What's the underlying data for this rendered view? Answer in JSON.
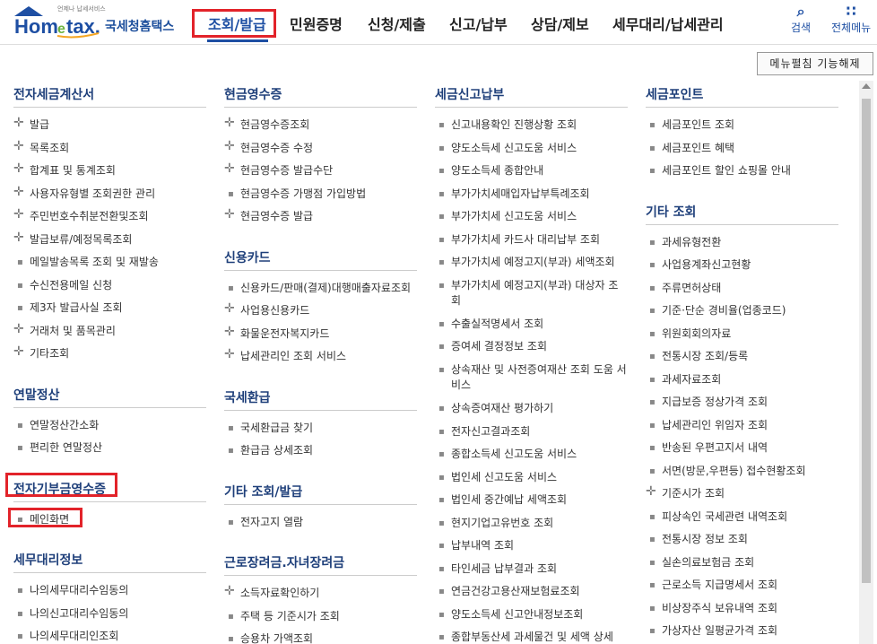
{
  "logo": {
    "small_text": "언제나 납세서비스",
    "name_ko": "국세청홈택스"
  },
  "gnb": [
    {
      "label": "조회/발급"
    },
    {
      "label": "민원증명"
    },
    {
      "label": "신청/제출"
    },
    {
      "label": "신고/납부"
    },
    {
      "label": "상담/제보"
    },
    {
      "label": "세무대리/납세관리"
    }
  ],
  "util": {
    "search": "검색",
    "all_menu": "전체메뉴"
  },
  "menu_toggle_button": "메뉴펼침 기능해제",
  "columns": [
    {
      "sections": [
        {
          "title": "전자세금계산서",
          "items": [
            {
              "t": "발급",
              "p": true
            },
            {
              "t": "목록조회",
              "p": true
            },
            {
              "t": "합계표 및 통계조회",
              "p": true
            },
            {
              "t": "사용자유형별 조회권한 관리",
              "p": true
            },
            {
              "t": "주민번호수취분전환및조회",
              "p": true
            },
            {
              "t": "발급보류/예정목록조회",
              "p": true
            },
            {
              "t": "메일발송목록 조회 및 재발송",
              "p": false
            },
            {
              "t": "수신전용메일 신청",
              "p": false
            },
            {
              "t": "제3자 발급사실 조회",
              "p": false
            },
            {
              "t": "거래처 및 품목관리",
              "p": true
            },
            {
              "t": "기타조회",
              "p": true
            }
          ]
        },
        {
          "title": "연말정산",
          "items": [
            {
              "t": "연말정산간소화",
              "p": false
            },
            {
              "t": "편리한 연말정산",
              "p": false
            }
          ]
        },
        {
          "title": "전자기부금영수증",
          "items": [
            {
              "t": "메인화면",
              "p": false
            }
          ]
        },
        {
          "title": "세무대리정보",
          "items": [
            {
              "t": "나의세무대리수임동의",
              "p": false
            },
            {
              "t": "나의신고대리수임동의",
              "p": false
            },
            {
              "t": "나의세무대리인조회",
              "p": false
            }
          ]
        }
      ]
    },
    {
      "sections": [
        {
          "title": "현금영수증",
          "items": [
            {
              "t": "현금영수증조회",
              "p": true
            },
            {
              "t": "현금영수증 수정",
              "p": true
            },
            {
              "t": "현금영수증 발급수단",
              "p": true
            },
            {
              "t": "현금영수증 가맹점 가입방법",
              "p": false
            },
            {
              "t": "현금영수증 발급",
              "p": true
            }
          ]
        },
        {
          "title": "신용카드",
          "items": [
            {
              "t": "신용카드/판매(결제)대행매출자료조회",
              "p": false
            },
            {
              "t": "사업용신용카드",
              "p": true
            },
            {
              "t": "화물운전자복지카드",
              "p": true
            },
            {
              "t": "납세관리인 조회 서비스",
              "p": true
            }
          ]
        },
        {
          "title": "국세환급",
          "items": [
            {
              "t": "국세환급금 찾기",
              "p": false
            },
            {
              "t": "환급금 상세조회",
              "p": false
            }
          ]
        },
        {
          "title": "기타 조회/발급",
          "items": [
            {
              "t": "전자고지 열람",
              "p": false
            }
          ]
        },
        {
          "title": "근로장려금.자녀장려금",
          "items": [
            {
              "t": "소득자료확인하기",
              "p": true
            },
            {
              "t": "주택 등 기준시가 조회",
              "p": false
            },
            {
              "t": "승용차 가액조회",
              "p": false
            }
          ]
        }
      ]
    },
    {
      "sections": [
        {
          "title": "세금신고납부",
          "items": [
            {
              "t": "신고내용확인 진행상황 조회",
              "p": false
            },
            {
              "t": "양도소득세 신고도움 서비스",
              "p": false
            },
            {
              "t": "양도소득세 종합안내",
              "p": false
            },
            {
              "t": "부가가치세매입자납부특례조회",
              "p": false
            },
            {
              "t": "부가가치세 신고도움 서비스",
              "p": false
            },
            {
              "t": "부가가치세 카드사 대리납부 조회",
              "p": false
            },
            {
              "t": "부가가치세 예정고지(부과) 세액조회",
              "p": false
            },
            {
              "t": "부가가치세 예정고지(부과) 대상자 조회",
              "p": false,
              "two": true
            },
            {
              "t": "수출실적명세서 조회",
              "p": false
            },
            {
              "t": "증여세 결정정보 조회",
              "p": false
            },
            {
              "t": "상속재산 및 사전증여재산 조회 도움 서비스",
              "p": false,
              "two": true
            },
            {
              "t": "상속증여재산 평가하기",
              "p": false
            },
            {
              "t": "전자신고결과조회",
              "p": false
            },
            {
              "t": "종합소득세 신고도움 서비스",
              "p": false
            },
            {
              "t": "법인세 신고도움 서비스",
              "p": false
            },
            {
              "t": "법인세 중간예납 세액조회",
              "p": false
            },
            {
              "t": "현지기업고유번호 조회",
              "p": false
            },
            {
              "t": "납부내역 조회",
              "p": false
            },
            {
              "t": "타인세금 납부결과 조회",
              "p": false
            },
            {
              "t": "연금건강고용산재보험료조회",
              "p": false
            },
            {
              "t": "양도소득세 신고안내정보조회",
              "p": false
            },
            {
              "t": "종합부동산세 과세물건 및 세액 상세",
              "p": false
            }
          ]
        }
      ]
    },
    {
      "sections": [
        {
          "title": "세금포인트",
          "items": [
            {
              "t": "세금포인트 조회",
              "p": false
            },
            {
              "t": "세금포인트 혜택",
              "p": false
            },
            {
              "t": "세금포인트 할인 쇼핑몰 안내",
              "p": false
            }
          ]
        },
        {
          "title": "기타 조회",
          "items": [
            {
              "t": "과세유형전환",
              "p": false
            },
            {
              "t": "사업용계좌신고현황",
              "p": false
            },
            {
              "t": "주류면허상태",
              "p": false
            },
            {
              "t": "기준·단순 경비율(업종코드)",
              "p": false
            },
            {
              "t": "위원회회의자료",
              "p": false
            },
            {
              "t": "전통시장 조회/등록",
              "p": false
            },
            {
              "t": "과세자료조회",
              "p": false
            },
            {
              "t": "지급보증 정상가격 조회",
              "p": false
            },
            {
              "t": "납세관리인 위임자 조회",
              "p": false
            },
            {
              "t": "반송된 우편고지서 내역",
              "p": false
            },
            {
              "t": "서면(방문,우편등) 접수현황조회",
              "p": false
            },
            {
              "t": "기준시가 조회",
              "p": true
            },
            {
              "t": "피상속인 국세관련 내역조회",
              "p": false
            },
            {
              "t": "전통시장 정보 조회",
              "p": false
            },
            {
              "t": "실손의료보험금 조회",
              "p": false
            },
            {
              "t": "근로소득 지급명세서 조회",
              "p": false
            },
            {
              "t": "비상장주식 보유내역 조회",
              "p": false
            },
            {
              "t": "가상자산 일평균가격 조회",
              "p": false
            }
          ]
        }
      ]
    }
  ]
}
